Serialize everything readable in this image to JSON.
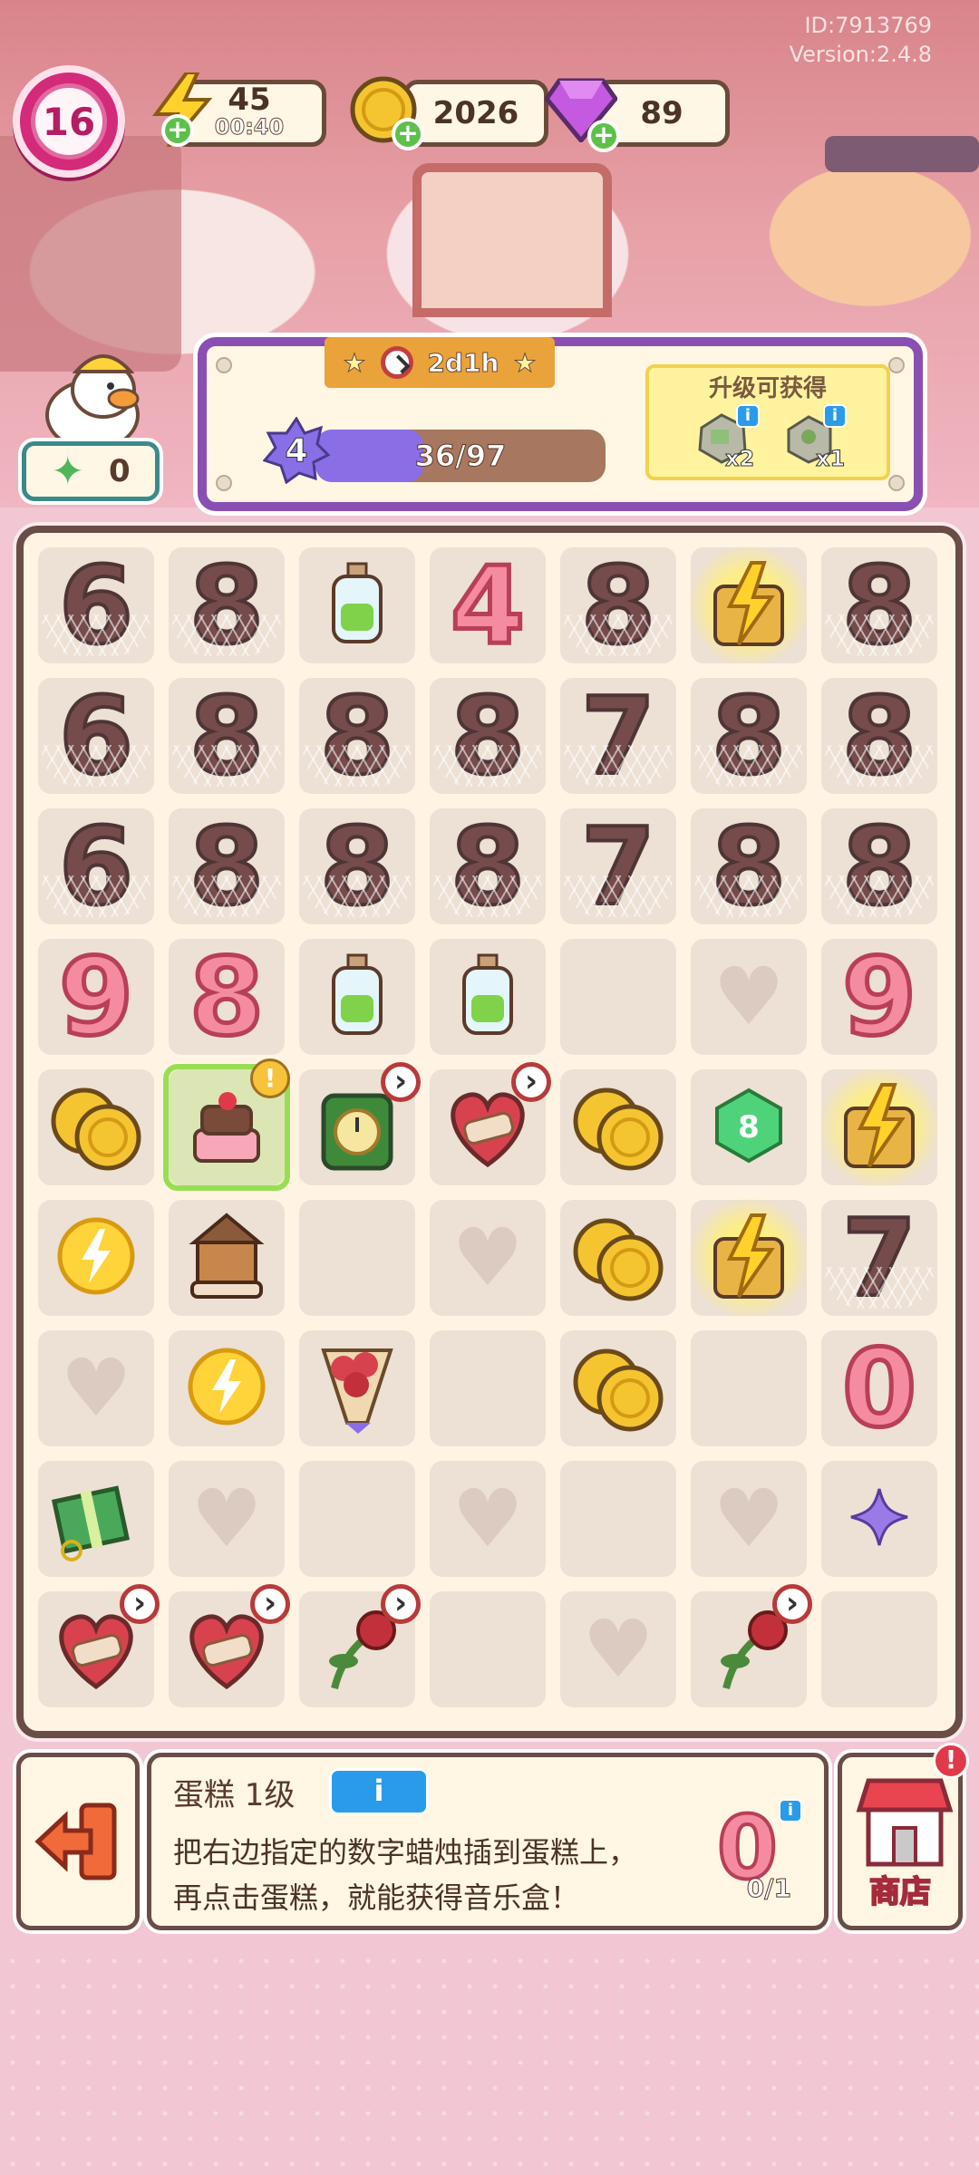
{
  "meta": {
    "id_text": "ID:7913769",
    "version_text": "Version:2.4.8"
  },
  "player": {
    "level": "16"
  },
  "resources": {
    "energy": {
      "value": "45",
      "timer": "00:40",
      "icon": "lightning-icon"
    },
    "coins": {
      "value": "2026",
      "icon": "coin-icon"
    },
    "gems": {
      "value": "89",
      "icon": "gem-icon"
    }
  },
  "stars": {
    "value": "0",
    "icon": "star-icon"
  },
  "level_panel": {
    "timer": "2d1h",
    "xp_level": "4",
    "xp_text": "36/97",
    "xp_current": 36,
    "xp_max": 97,
    "reward_title": "升级可获得",
    "rewards": [
      {
        "name": "stone-block-icon",
        "qty": "x2"
      },
      {
        "name": "stone-plant-icon",
        "qty": "x1"
      }
    ]
  },
  "board": {
    "rows": [
      [
        {
          "t": "locked",
          "v": "6"
        },
        {
          "t": "locked",
          "v": "8"
        },
        {
          "t": "bottle",
          "n": "green-potion-bottle"
        },
        {
          "t": "pink",
          "v": "4"
        },
        {
          "t": "locked",
          "v": "8"
        },
        {
          "t": "generator",
          "n": "cactus-generator"
        },
        {
          "t": "locked",
          "v": "8"
        }
      ],
      [
        {
          "t": "locked",
          "v": "6"
        },
        {
          "t": "locked",
          "v": "8"
        },
        {
          "t": "locked",
          "v": "8"
        },
        {
          "t": "locked",
          "v": "8"
        },
        {
          "t": "locked",
          "v": "7"
        },
        {
          "t": "locked",
          "v": "8"
        },
        {
          "t": "locked",
          "v": "8"
        }
      ],
      [
        {
          "t": "locked",
          "v": "6"
        },
        {
          "t": "locked",
          "v": "8"
        },
        {
          "t": "locked",
          "v": "8"
        },
        {
          "t": "locked",
          "v": "8"
        },
        {
          "t": "locked",
          "v": "7"
        },
        {
          "t": "locked",
          "v": "8"
        },
        {
          "t": "locked",
          "v": "8"
        }
      ],
      [
        {
          "t": "pink",
          "v": "9"
        },
        {
          "t": "pink",
          "v": "8"
        },
        {
          "t": "bottle",
          "n": "gummy-bear-jar"
        },
        {
          "t": "bottle",
          "n": "lightbulb-bottle"
        },
        {
          "t": "empty"
        },
        {
          "t": "heart"
        },
        {
          "t": "pink",
          "v": "9"
        }
      ],
      [
        {
          "t": "coins",
          "n": "two-coins"
        },
        {
          "t": "cake",
          "n": "strawberry-cake"
        },
        {
          "t": "clock",
          "n": "green-clock-box"
        },
        {
          "t": "bandheart",
          "n": "bandaged-heart"
        },
        {
          "t": "coins",
          "n": "coin-stack"
        },
        {
          "t": "gem",
          "n": "green-gem-8"
        },
        {
          "t": "generator",
          "n": "dark-generator"
        }
      ],
      [
        {
          "t": "energy",
          "n": "energy-orb-small"
        },
        {
          "t": "carousel",
          "n": "music-box"
        },
        {
          "t": "empty"
        },
        {
          "t": "heart"
        },
        {
          "t": "coins",
          "n": "single-coin"
        },
        {
          "t": "generator",
          "n": "cake-generator"
        },
        {
          "t": "locked",
          "v": "7"
        }
      ],
      [
        {
          "t": "heart"
        },
        {
          "t": "energy",
          "n": "energy-orb-large"
        },
        {
          "t": "bouquet",
          "n": "rose-bouquet"
        },
        {
          "t": "empty"
        },
        {
          "t": "coins",
          "n": "coin-pile"
        },
        {
          "t": "empty"
        },
        {
          "t": "pink",
          "v": "0"
        }
      ],
      [
        {
          "t": "gift",
          "n": "green-gift-box"
        },
        {
          "t": "heart"
        },
        {
          "t": "empty"
        },
        {
          "t": "heart"
        },
        {
          "t": "empty"
        },
        {
          "t": "heart"
        },
        {
          "t": "star",
          "n": "purple-star"
        }
      ],
      [
        {
          "t": "bandheart",
          "n": "bandaged-heart"
        },
        {
          "t": "bandheart",
          "n": "bandaged-heart"
        },
        {
          "t": "rose",
          "n": "wilted-rose"
        },
        {
          "t": "empty"
        },
        {
          "t": "heart"
        },
        {
          "t": "rose",
          "n": "wilted-rose"
        },
        {
          "t": "empty"
        }
      ]
    ]
  },
  "info_panel": {
    "title": "蛋糕 1级",
    "info_button": "i",
    "desc_line1": "把右边指定的数字蜡烛插到蛋糕上，",
    "desc_line2": "再点击蛋糕，就能获得音乐盒！",
    "required_count": "0/1",
    "required_icon": "pink-candle-0-icon"
  },
  "shop": {
    "label": "商店",
    "alert": "!"
  },
  "colors": {
    "accent_purple": "#8a4fb3",
    "board_border": "#6a4d46",
    "highlight_green": "#99dd55"
  }
}
